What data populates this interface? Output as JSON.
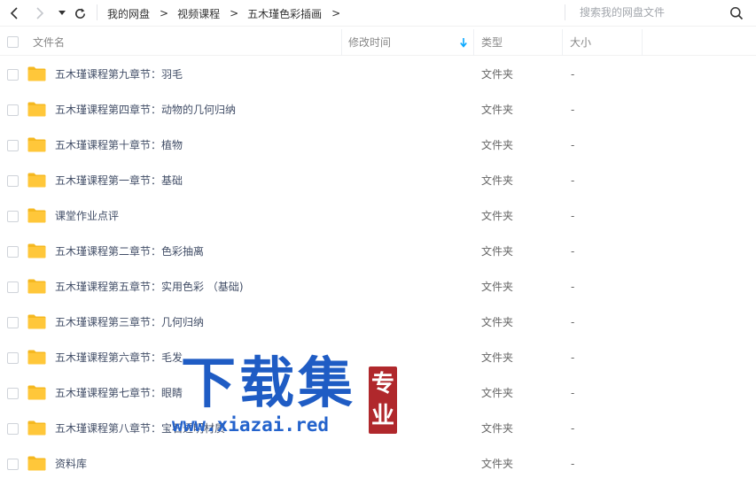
{
  "toolbar": {
    "back_icon": "chevron-left-icon",
    "forward_icon": "chevron-right-icon",
    "history_icon": "caret-down-icon",
    "refresh_icon": "refresh-icon",
    "breadcrumbs": [
      "我的网盘",
      "视频课程",
      "五木瑾色彩插画"
    ],
    "crumb_separator": ">",
    "search_placeholder": "搜索我的网盘文件",
    "search_icon": "search-icon"
  },
  "columns": {
    "name": "文件名",
    "modified": "修改时间",
    "type": "类型",
    "size": "大小",
    "sort_icon": "arrow-down-icon"
  },
  "files": [
    {
      "name": "五木瑾课程第九章节：羽毛",
      "type": "文件夹",
      "size": "-"
    },
    {
      "name": "五木瑾课程第四章节：动物的几何归纳",
      "type": "文件夹",
      "size": "-"
    },
    {
      "name": "五木瑾课程第十章节：植物",
      "type": "文件夹",
      "size": "-"
    },
    {
      "name": "五木瑾课程第一章节：基础",
      "type": "文件夹",
      "size": "-"
    },
    {
      "name": "课堂作业点评",
      "type": "文件夹",
      "size": "-"
    },
    {
      "name": "五木瑾课程第二章节：色彩抽离",
      "type": "文件夹",
      "size": "-"
    },
    {
      "name": "五木瑾课程第五章节：实用色彩 （基础)",
      "type": "文件夹",
      "size": "-"
    },
    {
      "name": "五木瑾课程第三章节：几何归纳",
      "type": "文件夹",
      "size": "-"
    },
    {
      "name": "五木瑾课程第六章节：毛发",
      "type": "文件夹",
      "size": "-"
    },
    {
      "name": "五木瑾课程第七章节：眼睛",
      "type": "文件夹",
      "size": "-"
    },
    {
      "name": "五木瑾课程第八章节：宝石透明材质",
      "type": "文件夹",
      "size": "-"
    },
    {
      "name": "资料库",
      "type": "文件夹",
      "size": "-"
    }
  ],
  "watermark": {
    "title": "下载集",
    "url": "www.xiazai.red",
    "seal": "专业"
  },
  "colors": {
    "folder": "#ffc73a",
    "folder_dark": "#f5b820",
    "sort_arrow": "#06a7ff",
    "watermark_blue": "#1f5cc4",
    "seal_red": "#b0282c"
  }
}
